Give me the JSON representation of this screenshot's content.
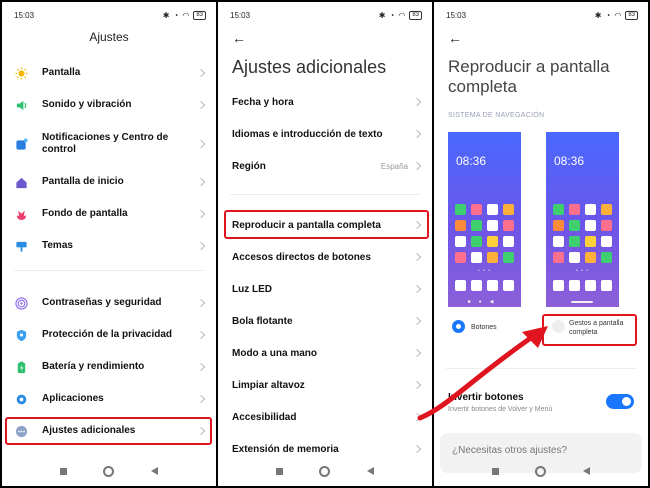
{
  "status": {
    "time": "15:03",
    "battery": "83"
  },
  "screen1": {
    "title": "Ajustes",
    "items": [
      {
        "label": "Pantalla",
        "icon": "sun-icon",
        "color": "#f5b800"
      },
      {
        "label": "Sonido y vibración",
        "icon": "speaker-icon",
        "color": "#2fbf71"
      },
      {
        "label": "Notificaciones y Centro de control",
        "icon": "notification-icon",
        "color": "#2a7de1"
      },
      {
        "label": "Pantalla de inicio",
        "icon": "home-icon",
        "color": "#6a5acd"
      },
      {
        "label": "Fondo de pantalla",
        "icon": "flower-icon",
        "color": "#e8406a"
      },
      {
        "label": "Temas",
        "icon": "theme-icon",
        "color": "#2a8de1"
      },
      {
        "label": "Contraseñas y seguridad",
        "icon": "fingerprint-icon",
        "color": "#8e6cf0"
      },
      {
        "label": "Protección de la privacidad",
        "icon": "shield-icon",
        "color": "#3aa0f0"
      },
      {
        "label": "Batería y rendimiento",
        "icon": "battery-icon",
        "color": "#2fbf71"
      },
      {
        "label": "Aplicaciones",
        "icon": "gear-icon",
        "color": "#2a8de1"
      },
      {
        "label": "Ajustes adicionales",
        "icon": "more-icon",
        "color": "#8fa3c8"
      }
    ]
  },
  "screen2": {
    "title": "Ajustes adicionales",
    "items": [
      {
        "label": "Fecha y hora",
        "value": ""
      },
      {
        "label": "Idiomas e introducción de texto",
        "value": ""
      },
      {
        "label": "Región",
        "value": "España"
      },
      {
        "label": "Reproducir a pantalla completa",
        "value": ""
      },
      {
        "label": "Accesos directos de botones",
        "value": ""
      },
      {
        "label": "Luz LED",
        "value": ""
      },
      {
        "label": "Bola flotante",
        "value": ""
      },
      {
        "label": "Modo a una mano",
        "value": ""
      },
      {
        "label": "Limpiar altavoz",
        "value": ""
      },
      {
        "label": "Accesibilidad",
        "value": ""
      },
      {
        "label": "Extensión de memoria",
        "value": ""
      }
    ]
  },
  "screen3": {
    "title": "Reproducir a pantalla completa",
    "section": "SISTEMA DE NAVEGACIÓN",
    "preview_time": "08:36",
    "option_buttons": "Botones",
    "option_gestures": "Gestos a pantalla completa",
    "invert_label": "Invertir botones",
    "invert_sub": "Invertir botones de Volver y Menú",
    "help": "¿Necesitas otros ajustes?"
  },
  "colors": {
    "accent": "#1976ff",
    "highlight": "#e0141e"
  }
}
